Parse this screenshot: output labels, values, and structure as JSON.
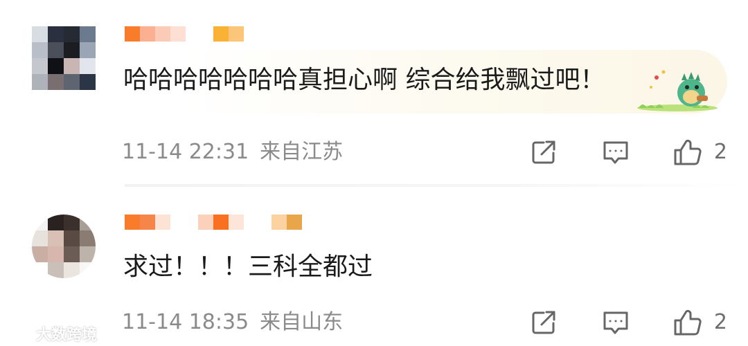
{
  "comments": [
    {
      "content": "哈哈哈哈哈哈哈真担心啊 综合给我飘过吧！",
      "time": "11-14 22:31",
      "location": "来自江苏",
      "likes": "2",
      "avatar_colors": [
        "#d8dde4",
        "#2b3040",
        "#262a33",
        "#6b7a8f",
        "#b9bfc9",
        "#4a4f59",
        "#1b1d22",
        "#9aa5b5",
        "#c4c8ce",
        "#0f1116",
        "#c9b5b3",
        "#e2e6ec",
        "#aeb3ba",
        "#7a6f70",
        "#5f6570",
        "#2c3545"
      ],
      "username_colors": [
        "#f97b2c",
        "#fbb091",
        "#fccbb7",
        "#fde0d3",
        "#f9b233",
        "#fbc57a"
      ]
    },
    {
      "content": "求过！！！三科全都过",
      "time": "11-14 18:35",
      "location": "来自山东",
      "likes": "2",
      "avatar_colors": [
        "#f4f4f4",
        "#2a2220",
        "#3b302c",
        "#a79e95",
        "#e8e2dc",
        "#d9c0b5",
        "#5a4a44",
        "#8a7c73",
        "#c9aea4",
        "#d7b7ad",
        "#6b5c55",
        "#bdb3aa",
        "#ffffff",
        "#c9c1b9",
        "#eae5df",
        "#f7f7f7"
      ],
      "username_colors": [
        "#f97b2c",
        "#f6854a",
        "#fde3d6",
        "#fcd1bb",
        "#f97021",
        "#fde5d9",
        "#fbd2a0",
        "#e9a54a"
      ]
    }
  ],
  "icons": {
    "share": "share-icon",
    "comment": "comment-icon",
    "like": "like-icon"
  },
  "watermark": {
    "text": "大数跨境"
  },
  "colors": {
    "meta_text": "#8a8a8a",
    "icon_stroke": "#666666",
    "content_text": "#1a1a1a"
  }
}
